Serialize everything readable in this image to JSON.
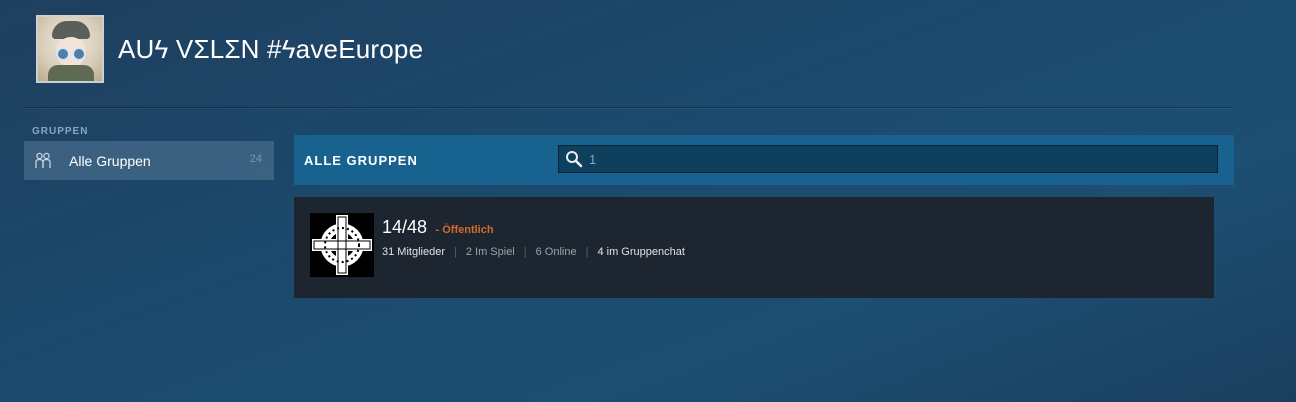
{
  "profile": {
    "username": "AUϟ VΣLΣN #ϟaveEurope",
    "avatar_icon": "avatar-image"
  },
  "sidebar": {
    "heading": "GRUPPEN",
    "items": [
      {
        "label": "Alle Gruppen",
        "count": "24",
        "icon": "groups-icon"
      }
    ]
  },
  "groups_panel": {
    "title": "ALLE GRUPPEN",
    "search": {
      "value": "1",
      "placeholder": "",
      "icon": "search-icon"
    }
  },
  "group_list": [
    {
      "name": "14/48",
      "privacy": "- Öffentlich",
      "stats": {
        "members": "31 Mitglieder",
        "in_game": "2 Im Spiel",
        "online": "6 Online",
        "in_chat": "4 im Gruppenchat"
      },
      "avatar_icon": "celtic-cross-icon"
    }
  ],
  "colors": {
    "accent_header": "#17628f",
    "privacy_public": "#d46a2e",
    "card_bg": "#1d2530"
  }
}
